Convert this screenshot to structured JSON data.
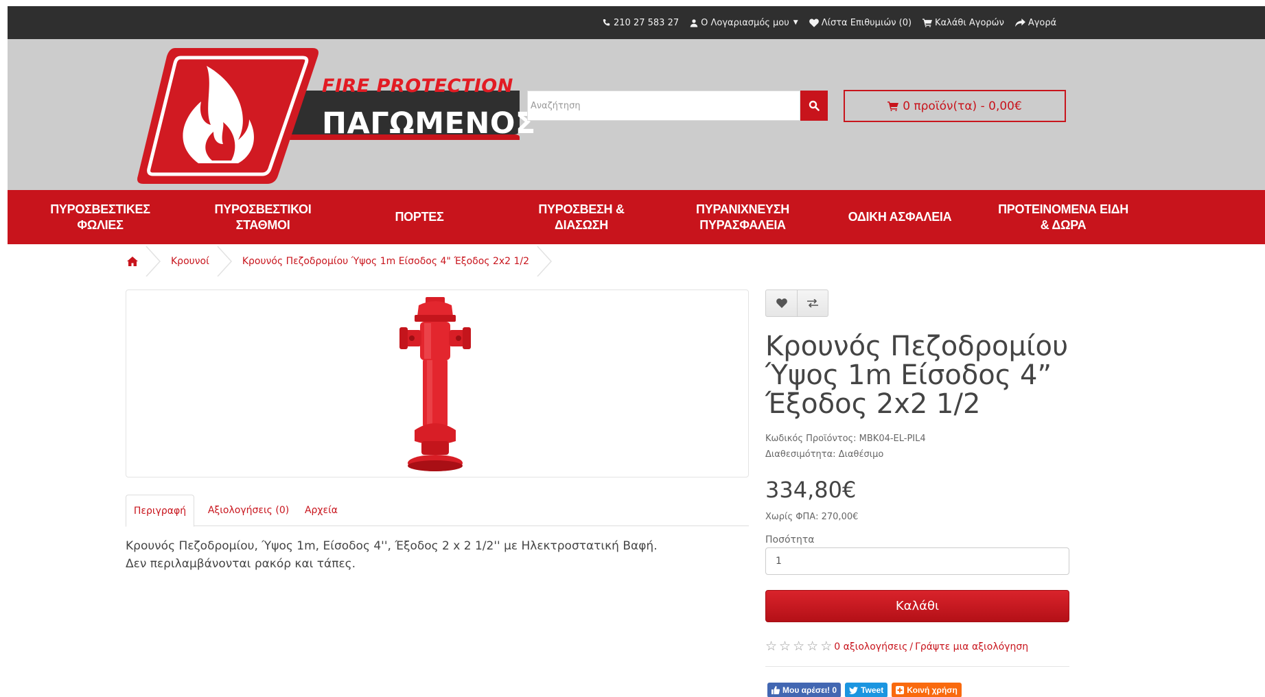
{
  "topbar": {
    "phone": "210 27 583 27",
    "account": "Ο Λογαριασμός μου",
    "wishlist": "Λίστα Επιθυμιών (0)",
    "cart": "Καλάθι Αγορών",
    "checkout": "Αγορά"
  },
  "logo": {
    "tagline": "FIRE PROTECTION",
    "name": "ΠΑΓΩΜΕΝΟΣ"
  },
  "search": {
    "placeholder": "Αναζήτηση"
  },
  "cart_summary": "0 προϊόν(τα) - 0,00€",
  "nav": [
    "ΠΥΡΟΣΒΕΣΤΙΚΕΣ\nΦΩΛΙΕΣ",
    "ΠΥΡΟΣΒΕΣΤΙΚΟΙ\nΣΤΑΘΜΟΙ",
    "ΠΟΡΤΕΣ",
    "ΠΥΡΟΣΒΕΣΗ &\nΔΙΑΣΩΣΗ",
    "ΠΥΡΑΝΙΧΝΕΥΣΗ\nΠΥΡΑΣΦΑΛΕΙΑ",
    "ΟΔΙΚΗ ΑΣΦΑΛΕΙΑ",
    "ΠΡΟΤΕΙΝΟΜΕΝΑ ΕΙΔΗ\n& ΔΩΡΑ"
  ],
  "breadcrumb": {
    "category": "Κρουνοί",
    "product": "Κρουνός Πεζοδρομίου Ύψος 1m Είσοδος 4\" Έξοδος 2x2 1/2"
  },
  "tabs": {
    "description": "Περιγραφή",
    "reviews": "Αξιολογήσεις (0)",
    "files": "Αρχεία"
  },
  "description": {
    "line1": "Κρουνός Πεζοδρομίου, Ύψος 1m, Είσοδος 4'', Έξοδος 2 x 2 1/2'' με Ηλεκτροστατική Βαφή.",
    "line2": "Δεν περιλαμβάνονται ρακόρ και τάπες."
  },
  "product": {
    "title": "Κρουνός Πεζοδρομίου Ύψος 1m Είσοδος 4” Έξοδος 2x2 1/2",
    "code": "Κωδικός Προϊόντος: MBK04-EL-PIL4",
    "availability": "Διαθεσιμότητα: Διαθέσιμο",
    "price": "334,80€",
    "price_ex_vat": "Χωρίς ΦΠΑ: 270,00€",
    "quantity_label": "Ποσότητα",
    "quantity_value": "1",
    "add_to_cart": "Καλάθι",
    "reviews_count": "0 αξιολογήσεις",
    "write_review": "Γράψτε μια αξιολόγηση",
    "rating_stars": 0
  },
  "share": {
    "facebook": "Μου αρέσει! 0",
    "twitter": "Tweet",
    "koinh": "Κοινή χρήση"
  },
  "colors": {
    "brand_red": "#c8141c",
    "topbar": "#2f2f2f",
    "header_bg": "#cccccc"
  }
}
